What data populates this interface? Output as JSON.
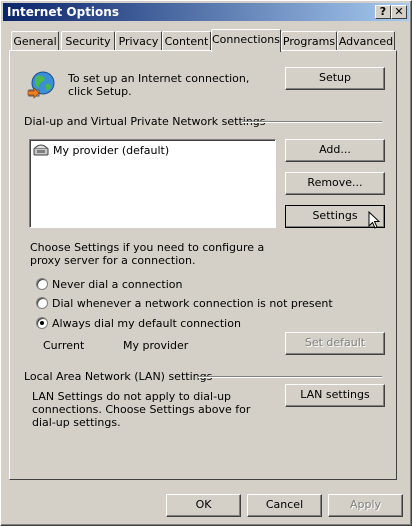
{
  "window": {
    "title": "Internet Options",
    "help_glyph": "?",
    "close_glyph": "✕"
  },
  "tabs": [
    "General",
    "Security",
    "Privacy",
    "Content",
    "Connections",
    "Programs",
    "Advanced"
  ],
  "active_tab": "Connections",
  "setup": {
    "text": "To set up an Internet connection, click Setup.",
    "button": "Setup"
  },
  "dialup": {
    "heading": "Dial-up and Virtual Private Network settings",
    "connections": [
      "My provider (default)"
    ],
    "buttons": {
      "add": "Add...",
      "remove": "Remove...",
      "settings": "Settings"
    }
  },
  "proxy_hint": "Choose Settings if you need to configure a proxy server for a connection.",
  "dial_options": [
    {
      "label": "Never dial a connection",
      "selected": false
    },
    {
      "label": "Dial whenever a network connection is not present",
      "selected": false
    },
    {
      "label": "Always dial my default connection",
      "selected": true
    }
  ],
  "current": {
    "label": "Current",
    "value": "My provider",
    "set_default": "Set default"
  },
  "lan": {
    "heading": "Local Area Network (LAN) settings",
    "text": "LAN Settings do not apply to dial-up connections. Choose Settings above for dial-up settings.",
    "button": "LAN settings"
  },
  "footer": {
    "ok": "OK",
    "cancel": "Cancel",
    "apply": "Apply"
  }
}
